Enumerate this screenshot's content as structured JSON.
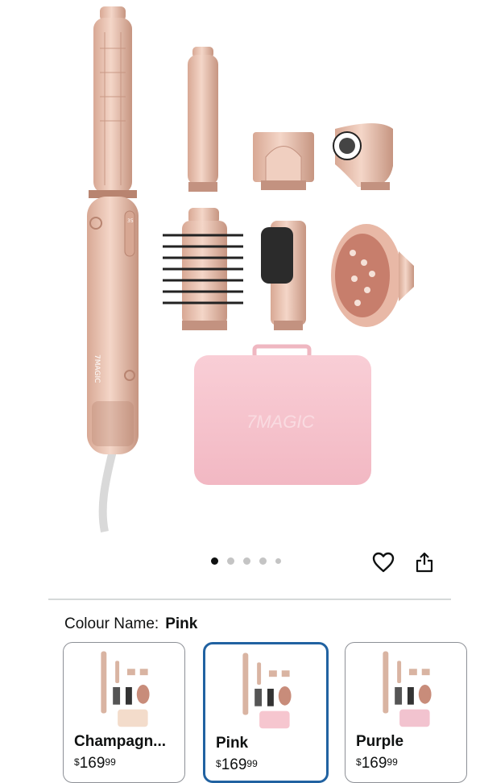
{
  "hero": {
    "brand_text_device": "7MAGIC",
    "brand_text_case": "7MAGIC",
    "device_button_label": "35"
  },
  "carousel": {
    "dot_count": 5,
    "active_index": 0
  },
  "actions": {
    "wishlist_icon": "heart-icon",
    "share_icon": "share-icon"
  },
  "colour": {
    "label": "Colour Name:",
    "selected": "Pink"
  },
  "swatches": [
    {
      "name": "Champagn...",
      "currency": "$",
      "price_whole": "169",
      "price_fraction": "99",
      "case_color": "#f3dccb",
      "selected": false
    },
    {
      "name": "Pink",
      "currency": "$",
      "price_whole": "169",
      "price_fraction": "99",
      "case_color": "#f6c6cf",
      "selected": true
    },
    {
      "name": "Purple",
      "currency": "$",
      "price_whole": "169",
      "price_fraction": "99",
      "case_color": "#f2c3cf",
      "selected": false
    }
  ],
  "colors": {
    "device": "#e6c3b1",
    "device_dark": "#c99a85",
    "case": "#f6c2ca",
    "accent_border": "#2162a1"
  }
}
